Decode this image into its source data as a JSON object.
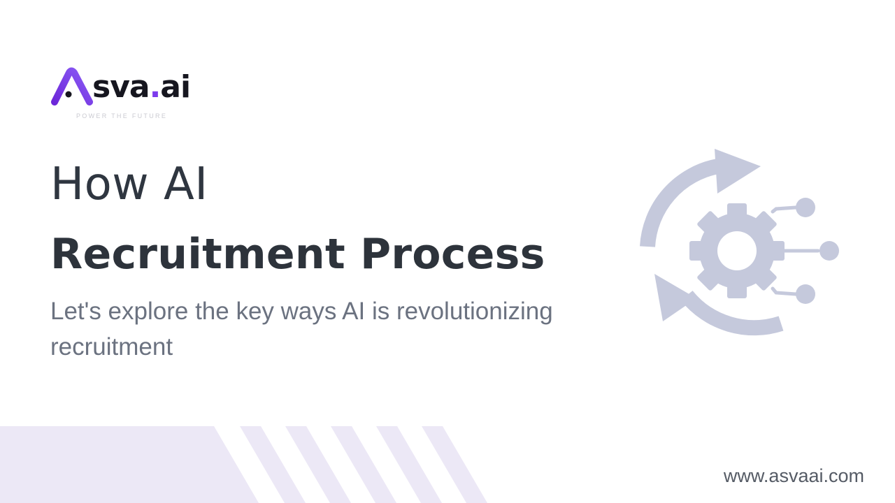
{
  "brand": {
    "name_prefix": "sva",
    "name_dot": ".",
    "name_suffix": "ai",
    "tagline": "POWER THE FUTURE",
    "accent_color": "#7c3aed"
  },
  "hero": {
    "title_line1": "How AI",
    "title_line2": "Recruitment Process",
    "subtitle": "Let's explore the key ways AI is revolutionizing recruitment"
  },
  "illustration": {
    "icon": "automation-gear-cycle-icon",
    "color": "#c5c9dc"
  },
  "footer": {
    "website": "www.asvaai.com",
    "stripe_color": "#ece8f6"
  }
}
